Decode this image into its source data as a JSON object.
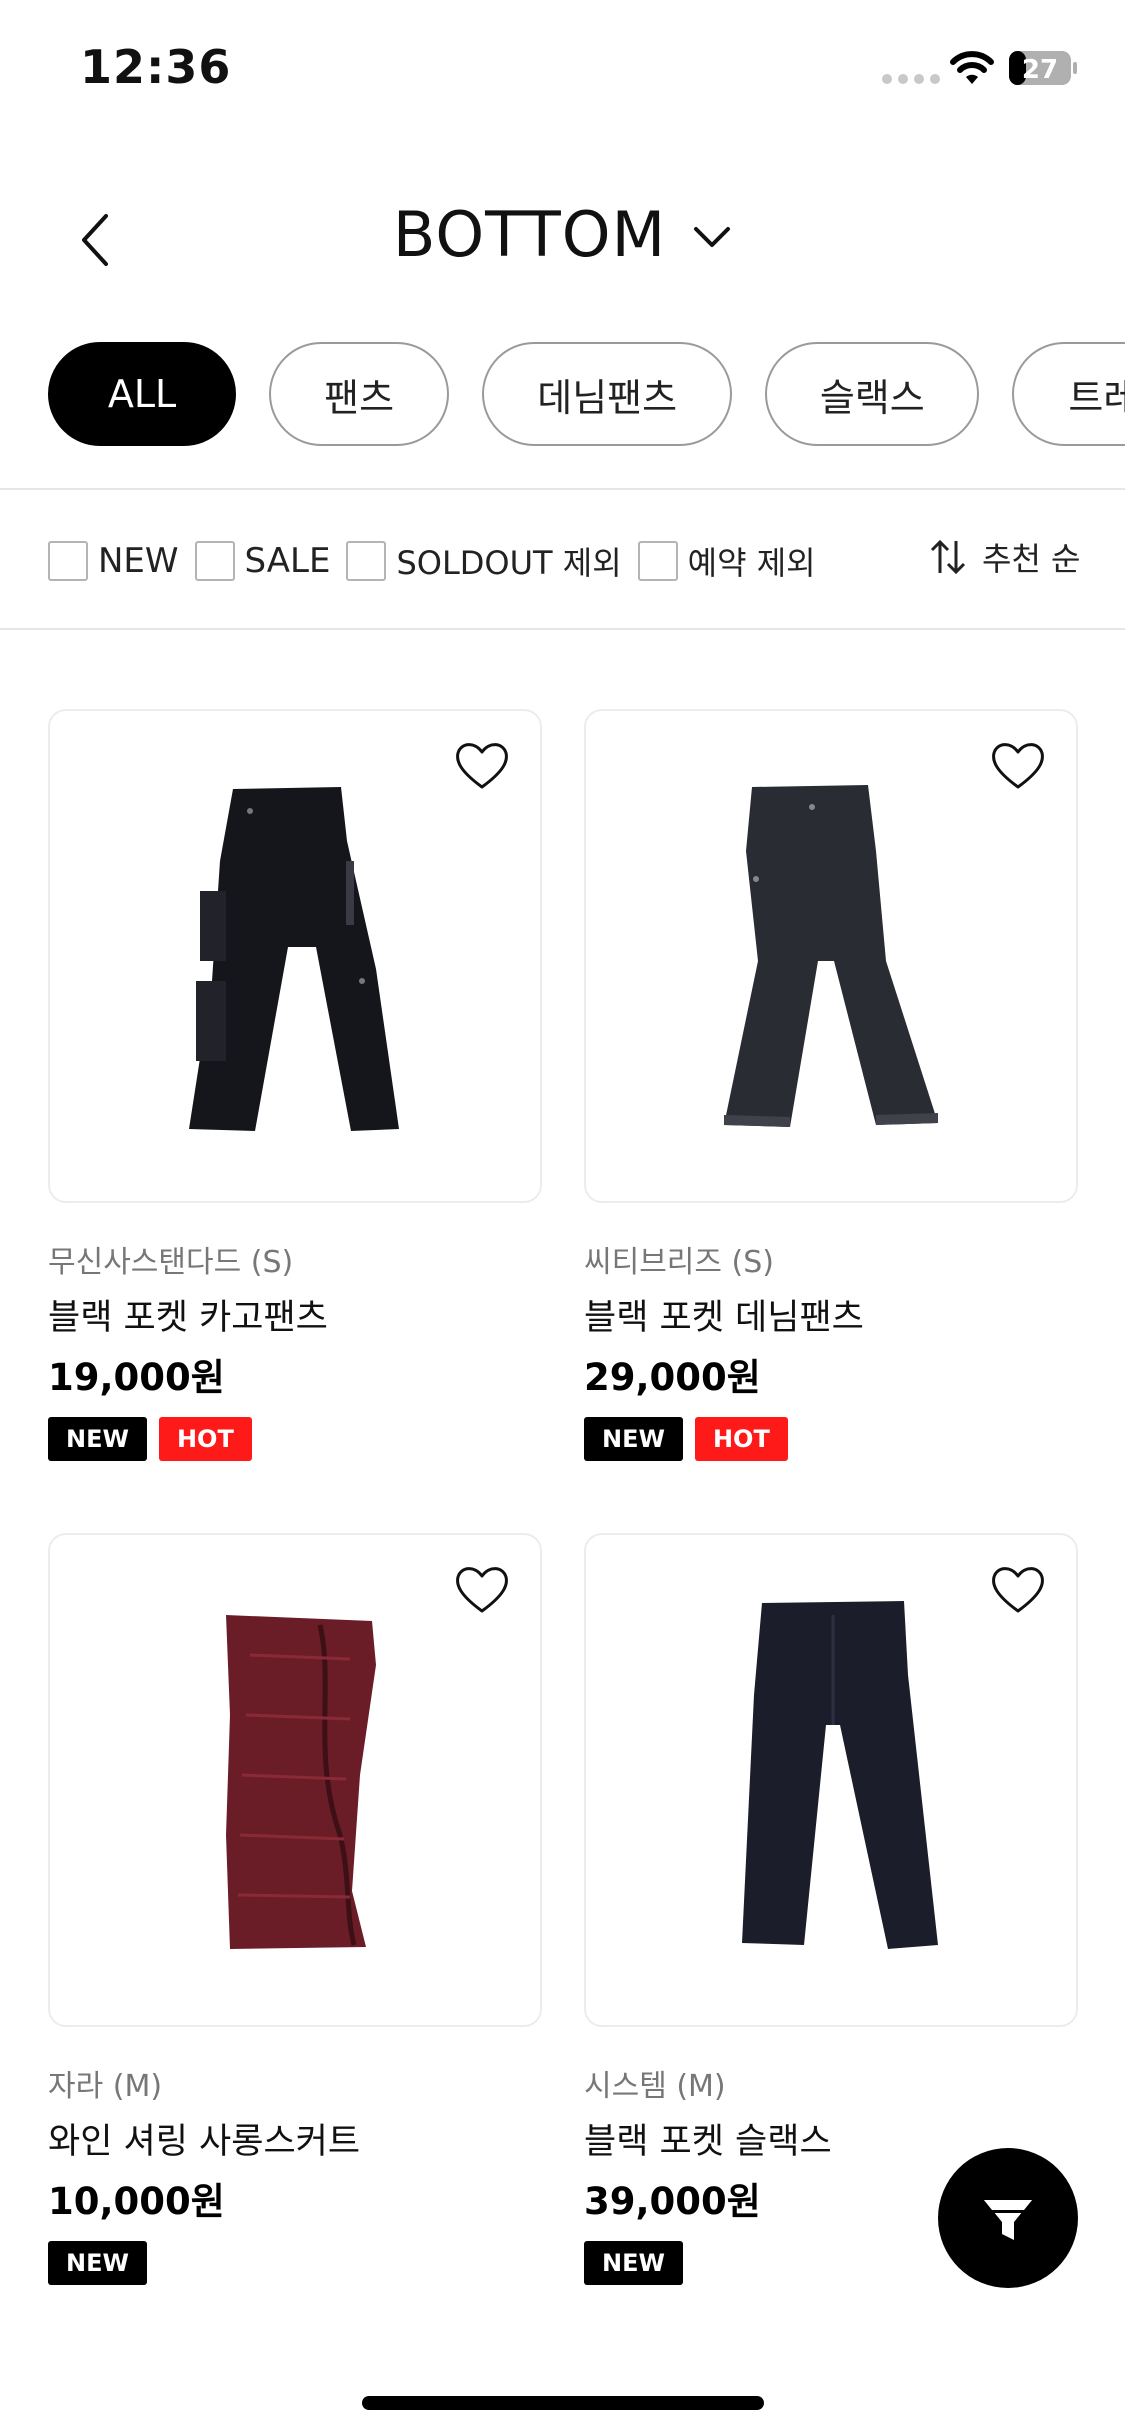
{
  "status_bar": {
    "time": "12:36",
    "battery": "27"
  },
  "header": {
    "title": "BOTTOM"
  },
  "categories": [
    {
      "label": "ALL",
      "active": true
    },
    {
      "label": "팬츠",
      "active": false
    },
    {
      "label": "데님팬츠",
      "active": false
    },
    {
      "label": "슬랙스",
      "active": false
    },
    {
      "label": "트레",
      "active": false
    }
  ],
  "filters": {
    "new": "NEW",
    "sale": "SALE",
    "soldout": "SOLDOUT 제외",
    "reserve": "예약 제외",
    "sort": "추천 순"
  },
  "products": [
    {
      "brand": "무신사스탠다드 (S)",
      "name": "블랙 포켓 카고팬츠",
      "price": "19,000원",
      "badges": [
        "NEW",
        "HOT"
      ]
    },
    {
      "brand": "씨티브리즈 (S)",
      "name": "블랙 포켓 데님팬츠",
      "price": "29,000원",
      "badges": [
        "NEW",
        "HOT"
      ]
    },
    {
      "brand": "자라 (M)",
      "name": "와인 셔링 사롱스커트",
      "price": "10,000원",
      "badges": [
        "NEW"
      ]
    },
    {
      "brand": "시스템 (M)",
      "name": "블랙 포켓 슬랙스",
      "price": "39,000원",
      "badges": [
        "NEW"
      ]
    }
  ],
  "icons": {
    "back": "chevron-left-icon",
    "dropdown": "chevron-down-icon",
    "sort": "sort-arrows-icon",
    "wishlist": "heart-outline-icon",
    "filter": "filter-funnel-icon"
  },
  "colors": {
    "accent": "#000000",
    "hot_badge": "#ff1a1a",
    "new_badge": "#000000"
  }
}
